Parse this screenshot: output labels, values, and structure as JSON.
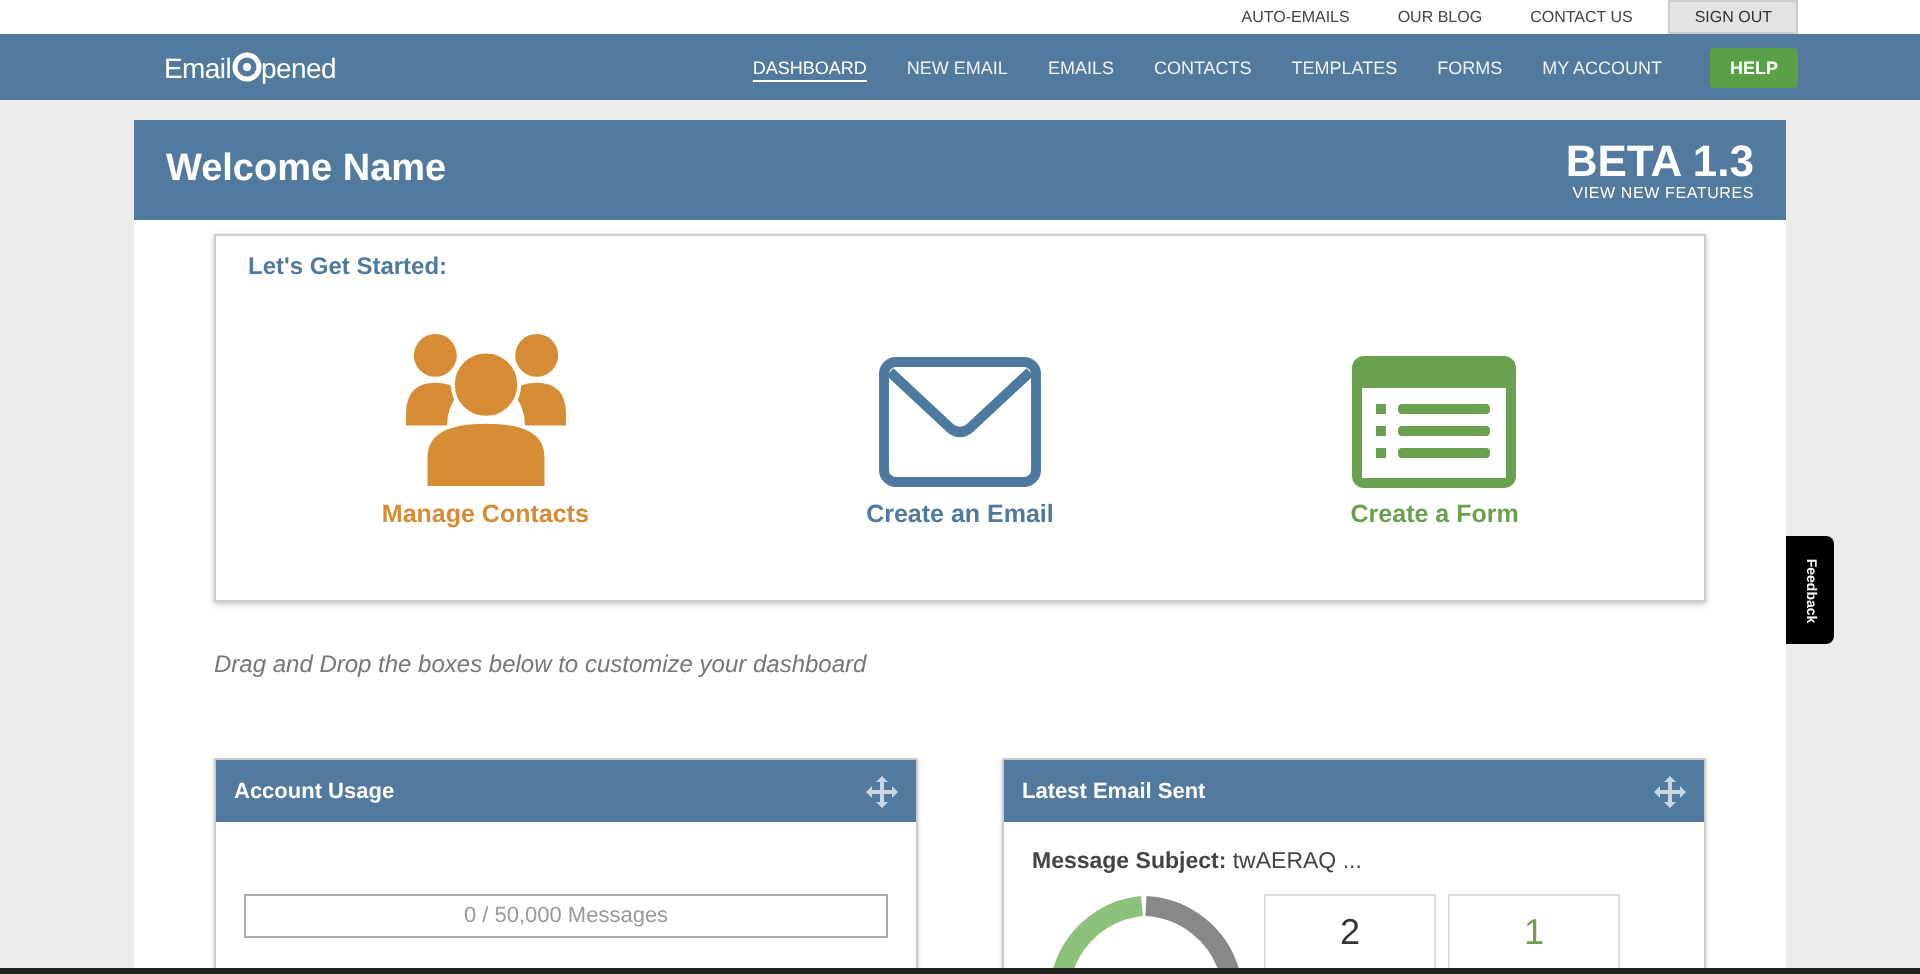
{
  "top_links": [
    {
      "label": "AUTO-EMAILS"
    },
    {
      "label": "OUR BLOG"
    },
    {
      "label": "CONTACT US"
    }
  ],
  "sign_out": "SIGN OUT",
  "logo": {
    "before": "Email",
    "after": "pened"
  },
  "nav": [
    {
      "label": "DASHBOARD",
      "selected": true
    },
    {
      "label": "NEW EMAIL",
      "selected": false
    },
    {
      "label": "EMAILS",
      "selected": false
    },
    {
      "label": "CONTACTS",
      "selected": false
    },
    {
      "label": "TEMPLATES",
      "selected": false
    },
    {
      "label": "FORMS",
      "selected": false
    },
    {
      "label": "MY ACCOUNT",
      "selected": false
    }
  ],
  "help": "HELP",
  "header": {
    "title": "Welcome Name",
    "version": "BETA 1.3",
    "version_link": "VIEW NEW FEATURES"
  },
  "get_started": {
    "title": "Let's Get Started:",
    "actions": [
      {
        "kind": "contacts",
        "label": "Manage Contacts",
        "color": "#d68c35"
      },
      {
        "kind": "email",
        "label": "Create an Email",
        "color": "#4f7aa0"
      },
      {
        "kind": "form",
        "label": "Create a Form",
        "color": "#6aa14f"
      }
    ]
  },
  "hint": "Drag and Drop the boxes below to customize your dashboard",
  "account_usage": {
    "title": "Account Usage",
    "reading": "0 / 50,000 Messages"
  },
  "latest_email": {
    "title": "Latest Email Sent",
    "subject_label": "Message Subject:",
    "subject": "twAERAQ ...",
    "stats": [
      {
        "value": "2",
        "color": "#333333"
      },
      {
        "value": "1",
        "color": "#6aa14f"
      }
    ]
  },
  "feedback": "Feedback"
}
